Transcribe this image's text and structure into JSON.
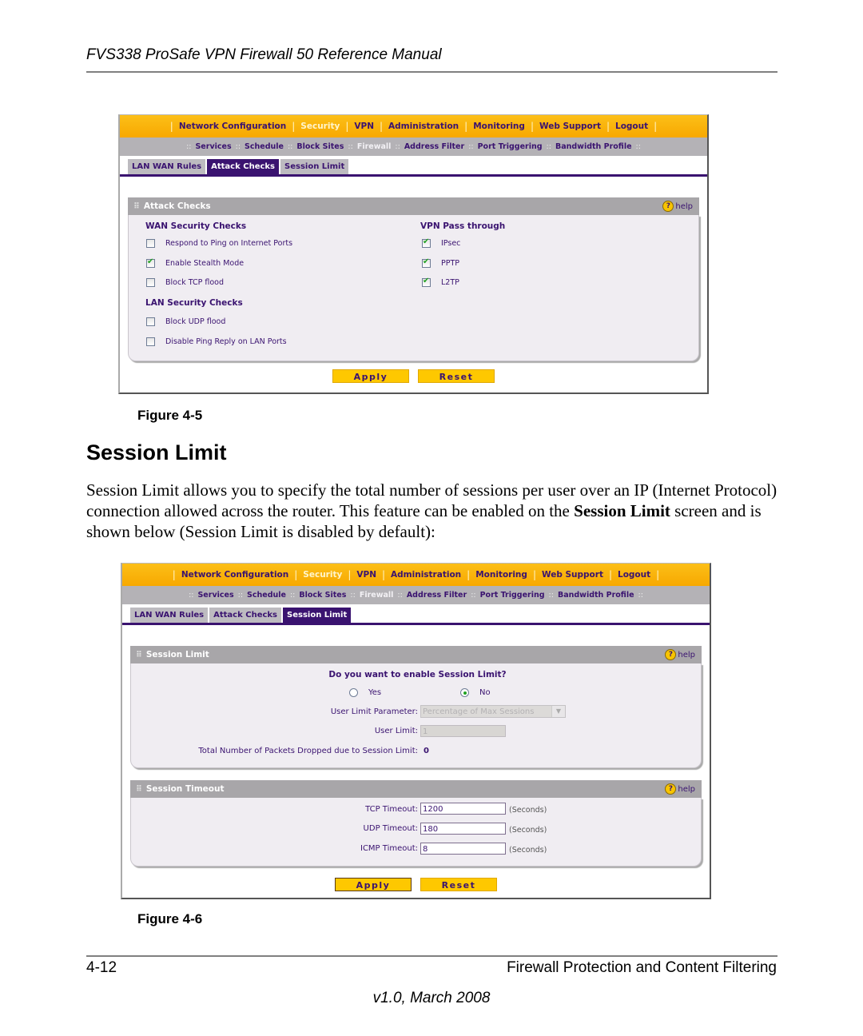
{
  "header": {
    "manual_title": "FVS338 ProSafe VPN Firewall 50 Reference Manual"
  },
  "nav": {
    "top_items": [
      {
        "label": "Network Configuration",
        "active": false
      },
      {
        "label": "Security",
        "active": true
      },
      {
        "label": "VPN",
        "active": false
      },
      {
        "label": "Administration",
        "active": false
      },
      {
        "label": "Monitoring",
        "active": false
      },
      {
        "label": "Web Support",
        "active": false
      },
      {
        "label": "Logout",
        "active": false
      }
    ],
    "sub_items": [
      {
        "label": "Services",
        "active": false
      },
      {
        "label": "Schedule",
        "active": false
      },
      {
        "label": "Block Sites",
        "active": false
      },
      {
        "label": "Firewall",
        "active": true
      },
      {
        "label": "Address Filter",
        "active": false
      },
      {
        "label": "Port Triggering",
        "active": false
      },
      {
        "label": "Bandwidth Profile",
        "active": false
      }
    ],
    "tabs": [
      "LAN WAN Rules",
      "Attack Checks",
      "Session Limit"
    ]
  },
  "figure1": {
    "active_tab": "Attack Checks",
    "section_title": "Attack Checks",
    "help_label": "help",
    "wan_title": "WAN Security Checks",
    "wan_items": [
      {
        "label": "Respond to Ping on Internet Ports",
        "checked": false
      },
      {
        "label": "Enable Stealth Mode",
        "checked": true
      },
      {
        "label": "Block TCP flood",
        "checked": false
      }
    ],
    "vpn_title": "VPN Pass through",
    "vpn_items": [
      {
        "label": "IPsec",
        "checked": true
      },
      {
        "label": "PPTP",
        "checked": true
      },
      {
        "label": "L2TP",
        "checked": true
      }
    ],
    "lan_title": "LAN Security Checks",
    "lan_items": [
      {
        "label": "Block UDP flood",
        "checked": false
      },
      {
        "label": "Disable Ping Reply on LAN Ports",
        "checked": false
      }
    ],
    "apply_label": "Apply",
    "reset_label": "Reset",
    "caption": "Figure 4-5"
  },
  "section": {
    "title": "Session Limit",
    "paragraph_before": "Session Limit allows you to specify the total number of sessions per user over an IP (Internet Protocol) connection allowed across the router. This feature can be enabled on the ",
    "paragraph_bold": "Session Limit",
    "paragraph_after": " screen and is shown below (Session Limit is disabled by default):"
  },
  "figure2": {
    "active_tab": "Session Limit",
    "session_limit": {
      "section_title": "Session Limit",
      "help_label": "help",
      "question": "Do you want to enable Session Limit?",
      "yes_label": "Yes",
      "no_label": "No",
      "selected": "No",
      "param_label": "User Limit Parameter:",
      "param_value": "Percentage of Max Sessions",
      "user_limit_label": "User Limit:",
      "user_limit_value": "1",
      "dropped_label": "Total Number of Packets Dropped due to Session Limit:",
      "dropped_value": "0"
    },
    "session_timeout": {
      "section_title": "Session Timeout",
      "help_label": "help",
      "tcp_label": "TCP Timeout:",
      "tcp_value": "1200",
      "udp_label": "UDP Timeout:",
      "udp_value": "180",
      "icmp_label": "ICMP Timeout:",
      "icmp_value": "8",
      "unit": "(Seconds)"
    },
    "apply_label": "Apply",
    "reset_label": "Reset",
    "caption": "Figure 4-6"
  },
  "footer": {
    "page_number": "4-12",
    "chapter": "Firewall Protection and Content Filtering",
    "version": "v1.0, March 2008"
  }
}
